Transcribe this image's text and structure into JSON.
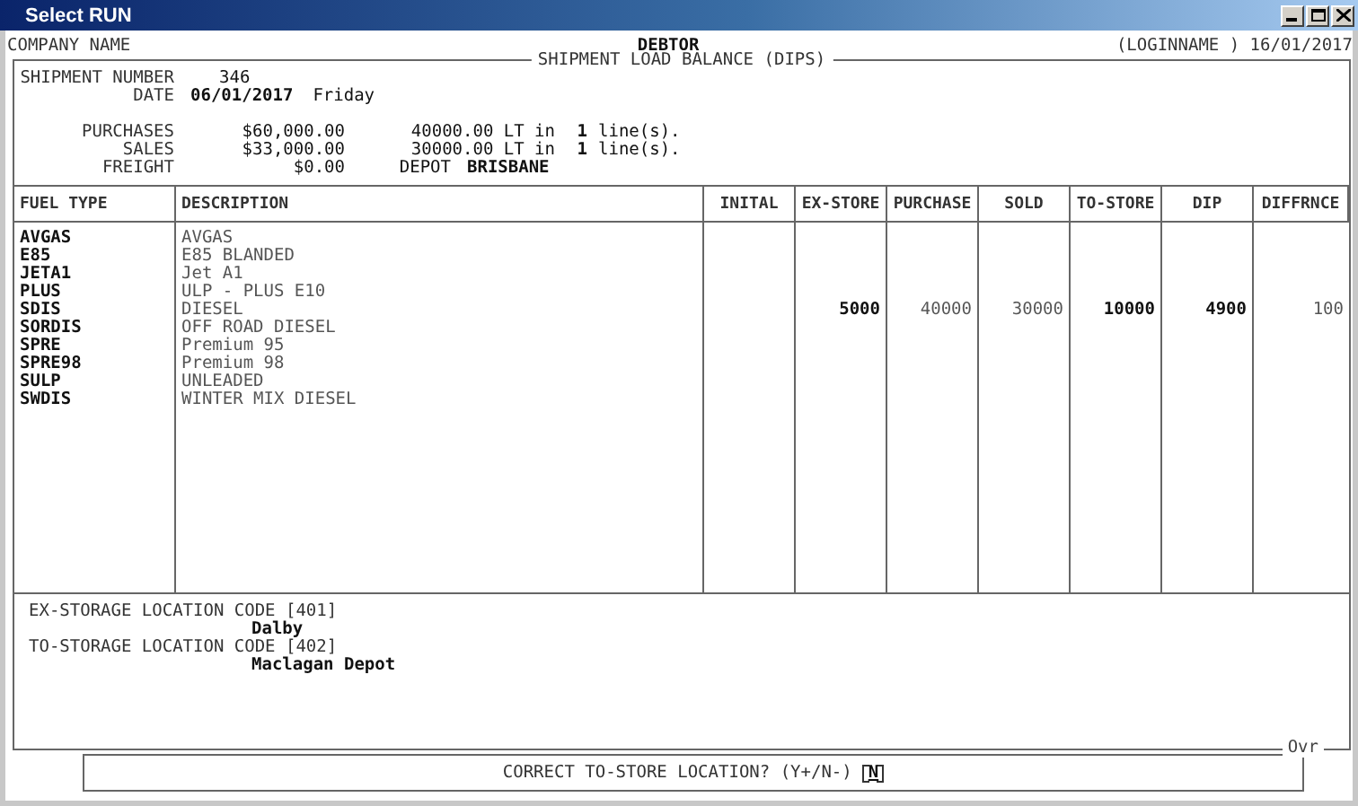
{
  "window": {
    "title": "Select RUN"
  },
  "header": {
    "company": "COMPANY NAME",
    "module": "DEBTOR",
    "login": "(LOGINNAME ) 16/01/2017"
  },
  "panel_title": "SHIPMENT LOAD BALANCE (DIPS)",
  "shipment": {
    "number_label": "SHIPMENT NUMBER",
    "number": "346",
    "date_label": "DATE",
    "date": "06/01/2017",
    "day": "Friday"
  },
  "totals": [
    {
      "label": "PURCHASES",
      "amount": "$60,000.00",
      "quantity": "40000.00 LT in",
      "count": "1",
      "unit": "line(s)."
    },
    {
      "label": "SALES",
      "amount": "$33,000.00",
      "quantity": "30000.00 LT in",
      "count": "1",
      "unit": "line(s)."
    }
  ],
  "freight": {
    "label": "FREIGHT",
    "amount": "$0.00",
    "depot_label": "DEPOT",
    "depot": "BRISBANE"
  },
  "table": {
    "columns": [
      "FUEL TYPE",
      "DESCRIPTION",
      "INITAL",
      "EX-STORE",
      "PURCHASE",
      "SOLD",
      "TO-STORE",
      "DIP",
      "DIFFRNCE"
    ],
    "rows": [
      {
        "fuel_type": "AVGAS",
        "description": "AVGAS"
      },
      {
        "fuel_type": "E85",
        "description": "E85 BLANDED"
      },
      {
        "fuel_type": "JETA1",
        "description": "Jet A1"
      },
      {
        "fuel_type": "PLUS",
        "description": "ULP - PLUS E10"
      },
      {
        "fuel_type": "SDIS",
        "description": "DIESEL",
        "values": [
          {
            "text": "5000",
            "strong": true
          },
          {
            "text": "40000",
            "strong": false
          },
          {
            "text": "30000",
            "strong": false
          },
          {
            "text": "10000",
            "strong": true
          },
          {
            "text": "4900",
            "strong": true
          },
          {
            "text": "100",
            "strong": false
          }
        ]
      },
      {
        "fuel_type": "SORDIS",
        "description": "OFF ROAD DIESEL"
      },
      {
        "fuel_type": "SPRE",
        "description": "Premium 95"
      },
      {
        "fuel_type": "SPRE98",
        "description": "Premium 98"
      },
      {
        "fuel_type": "SULP",
        "description": "UNLEADED"
      },
      {
        "fuel_type": "SWDIS",
        "description": "WINTER MIX DIESEL"
      }
    ]
  },
  "locations": [
    {
      "label": "EX-STORAGE LOCATION CODE [401]",
      "name": "Dalby"
    },
    {
      "label": "TO-STORAGE LOCATION CODE [402]",
      "name": "Maclagan Depot"
    }
  ],
  "mode": "Ovr",
  "prompt": {
    "question": "CORRECT TO-STORE LOCATION? (Y+/N-)",
    "answer": "N"
  }
}
